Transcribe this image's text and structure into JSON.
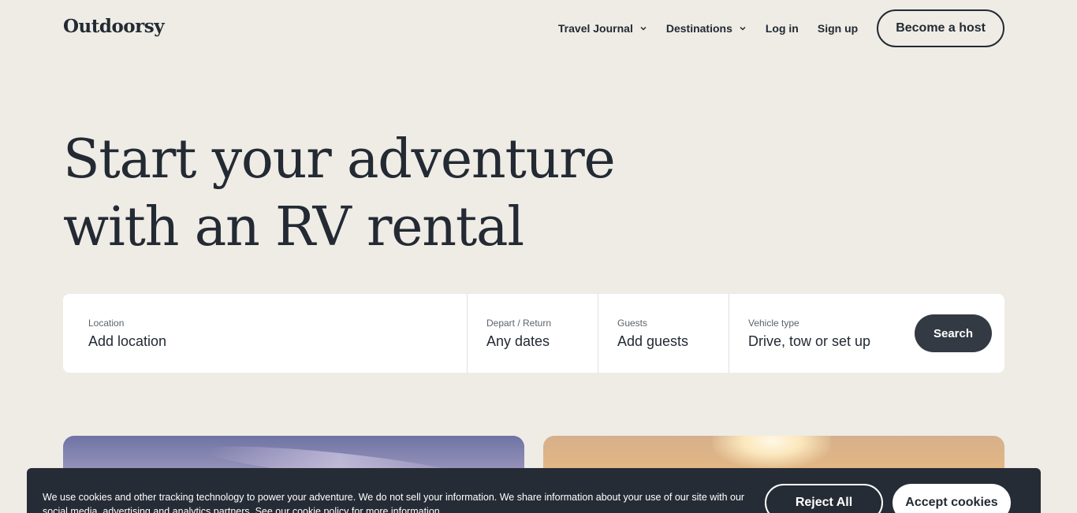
{
  "brand": {
    "logo_text": "Outdoorsy"
  },
  "nav": {
    "travel_journal": "Travel Journal",
    "destinations": "Destinations",
    "log_in": "Log in",
    "sign_up": "Sign up",
    "become_host": "Become a host"
  },
  "hero": {
    "line1": "Start your adventure",
    "line2": "with an RV rental"
  },
  "search": {
    "location": {
      "label": "Location",
      "value": "Add location"
    },
    "dates": {
      "label": "Depart / Return",
      "value": "Any dates"
    },
    "guests": {
      "label": "Guests",
      "value": "Add guests"
    },
    "vehicle": {
      "label": "Vehicle type",
      "value": "Drive, tow or set up"
    },
    "button": "Search"
  },
  "cookies": {
    "text_before": "We use cookies and other tracking technology to power your adventure. We do not sell your information. We share information about your use of our site with our social media, advertising and analytics partners. See our ",
    "link": "cookie policy",
    "text_after": " for more information.",
    "reject": "Reject All",
    "accept": "Accept cookies"
  },
  "icons": {
    "chevron": "chevron-down-icon"
  },
  "colors": {
    "background": "#eeece5",
    "text": "#232a33",
    "search_button": "#343a43",
    "banner": "#262c35"
  }
}
